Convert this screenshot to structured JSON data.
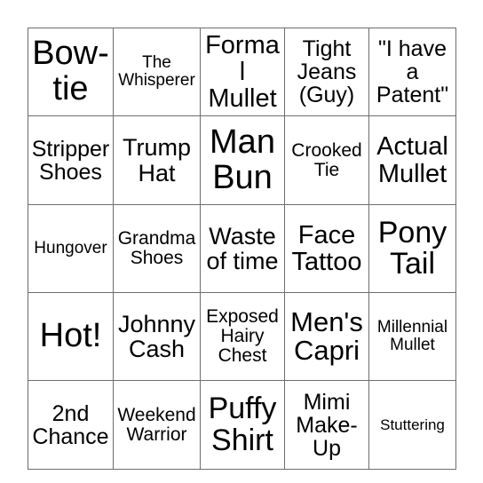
{
  "card": {
    "type": "bingo-card",
    "grid_size": "5x5",
    "border_color": "#6e6e6e",
    "background_color": "#ffffff",
    "text_color": "#000000",
    "rows": [
      [
        {
          "text": "Bow-tie",
          "size": "fs-38"
        },
        {
          "text": "The Whisperer",
          "size": "fs-19"
        },
        {
          "text": "Formal Mullet",
          "size": "fs-29"
        },
        {
          "text": "Tight Jeans (Guy)",
          "size": "fs-25"
        },
        {
          "text": "\"I have a Patent\"",
          "size": "fs-25"
        }
      ],
      [
        {
          "text": "Stripper Shoes",
          "size": "fs-25"
        },
        {
          "text": "Trump Hat",
          "size": "fs-27"
        },
        {
          "text": "Man Bun",
          "size": "fs-38"
        },
        {
          "text": "Crooked Tie",
          "size": "fs-21"
        },
        {
          "text": "Actual Mullet",
          "size": "fs-29"
        }
      ],
      [
        {
          "text": "Hungover",
          "size": "fs-19"
        },
        {
          "text": "Grandma Shoes",
          "size": "fs-21"
        },
        {
          "text": "Waste of time",
          "size": "fs-27"
        },
        {
          "text": "Face Tattoo",
          "size": "fs-29"
        },
        {
          "text": "Pony Tail",
          "size": "fs-34"
        }
      ],
      [
        {
          "text": "Hot!",
          "size": "fs-38"
        },
        {
          "text": "Johnny Cash",
          "size": "fs-27"
        },
        {
          "text": "Exposed Hairy Chest",
          "size": "fs-21"
        },
        {
          "text": "Men's Capri",
          "size": "fs-31"
        },
        {
          "text": "Millennial Mullet",
          "size": "fs-19"
        }
      ],
      [
        {
          "text": "2nd Chance",
          "size": "fs-25"
        },
        {
          "text": "Weekend Warrior",
          "size": "fs-21"
        },
        {
          "text": "Puffy Shirt",
          "size": "fs-34"
        },
        {
          "text": "Mimi Make-Up",
          "size": "fs-25"
        },
        {
          "text": "Stuttering",
          "size": "fs-17"
        }
      ]
    ]
  }
}
